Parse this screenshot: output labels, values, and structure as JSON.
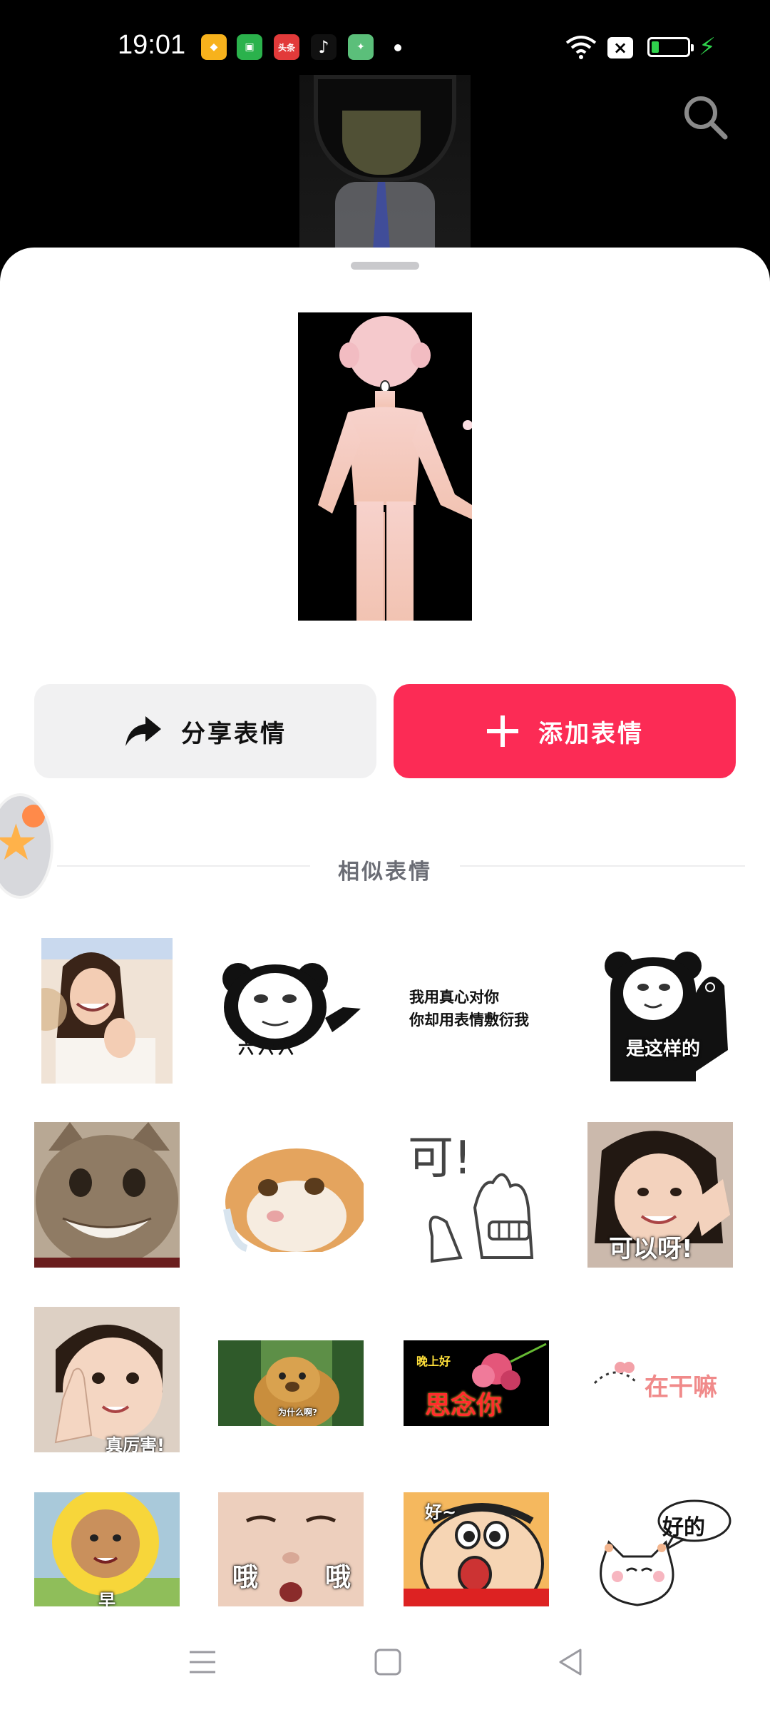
{
  "status_bar": {
    "time": "19:01",
    "apps": [
      {
        "icon": "diamond-app-icon",
        "color": "#f7b21c",
        "label": ""
      },
      {
        "icon": "shopping-bag-app-icon",
        "color": "#2bb24c",
        "label": ""
      },
      {
        "icon": "toutiao-app-icon",
        "color": "#e23a3a",
        "label": "头条"
      },
      {
        "icon": "tiktok-app-icon",
        "color": "#111111",
        "label": ""
      },
      {
        "icon": "game-app-icon",
        "color": "#5bbf7a",
        "label": ""
      }
    ],
    "battery_color": "#2fd24c"
  },
  "header": {
    "search_icon": "search-icon"
  },
  "actions": {
    "share_label": "分享表情",
    "add_label": "添加表情",
    "add_color": "#fc2b55"
  },
  "similar": {
    "title": "相似表情",
    "items": [
      {
        "name": "sticker-smiling-woman",
        "caption": ""
      },
      {
        "name": "sticker-panda-666",
        "caption": "六六六"
      },
      {
        "name": "sticker-text-heart",
        "caption": "我用真心对你\n你却用表情敷衍我"
      },
      {
        "name": "sticker-panda-thumb",
        "caption": "是这样的"
      },
      {
        "name": "sticker-grinning-cat",
        "caption": ""
      },
      {
        "name": "sticker-crying-cat",
        "caption": ""
      },
      {
        "name": "sticker-ke-rabbit",
        "caption": "可!"
      },
      {
        "name": "sticker-girl-keyiya",
        "caption": "可以呀!"
      },
      {
        "name": "sticker-kid-thumb",
        "caption": "真厉害!"
      },
      {
        "name": "sticker-bear",
        "caption": "为什么啊?"
      },
      {
        "name": "sticker-evening-flowers",
        "caption_top": "晚上好",
        "caption": "思念你"
      },
      {
        "name": "sticker-cat-zaiganma",
        "caption": "在干嘛"
      },
      {
        "name": "sticker-sun-baby",
        "caption": "早"
      },
      {
        "name": "sticker-baby-oh",
        "caption_left": "哦",
        "caption": "哦"
      },
      {
        "name": "sticker-shinchan",
        "caption": "好~"
      },
      {
        "name": "sticker-cat-haode",
        "caption": "好的"
      }
    ]
  }
}
